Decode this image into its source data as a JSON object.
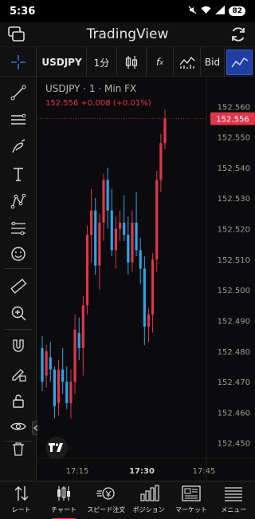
{
  "status_bar": {
    "time": "5:36",
    "battery": "82"
  },
  "header": {
    "title": "TradingView"
  },
  "toolbar": {
    "symbol": "USDJPY",
    "interval": "1分",
    "fx_label": "f",
    "fx_sub": "x",
    "price_source": "Bid"
  },
  "legend": {
    "title": "USDJPY · 1 · Min FX",
    "last": "152.556",
    "change": "+0.008 (+0.01%)"
  },
  "colors": {
    "up": "#e0364a",
    "down": "#2fa4e7",
    "accent": "#1f3fa3",
    "label_bg": "#e0364a"
  },
  "chart_data": {
    "type": "candlestick",
    "title": "USDJPY · 1 · Min FX",
    "y_ticks": [
      "152.560",
      "152.550",
      "152.540",
      "152.530",
      "152.520",
      "152.510",
      "152.500",
      "152.490",
      "152.480",
      "152.470",
      "152.460",
      "152.450"
    ],
    "x_ticks": [
      "17:15",
      "17:30",
      "17:45"
    ],
    "ylim": [
      152.446,
      152.564
    ],
    "last_price_label": "152.556",
    "candles": [
      {
        "o": 152.481,
        "h": 152.485,
        "l": 152.467,
        "c": 152.47
      },
      {
        "o": 152.472,
        "h": 152.482,
        "l": 152.468,
        "c": 152.48
      },
      {
        "o": 152.478,
        "h": 152.483,
        "l": 152.47,
        "c": 152.474
      },
      {
        "o": 152.474,
        "h": 152.475,
        "l": 152.458,
        "c": 152.462
      },
      {
        "o": 152.463,
        "h": 152.477,
        "l": 152.459,
        "c": 152.474
      },
      {
        "o": 152.474,
        "h": 152.481,
        "l": 152.466,
        "c": 152.47
      },
      {
        "o": 152.47,
        "h": 152.475,
        "l": 152.461,
        "c": 152.463
      },
      {
        "o": 152.463,
        "h": 152.474,
        "l": 152.458,
        "c": 152.47
      },
      {
        "o": 152.47,
        "h": 152.492,
        "l": 152.466,
        "c": 152.487
      },
      {
        "o": 152.486,
        "h": 152.491,
        "l": 152.477,
        "c": 152.481
      },
      {
        "o": 152.481,
        "h": 152.498,
        "l": 152.472,
        "c": 152.495
      },
      {
        "o": 152.495,
        "h": 152.521,
        "l": 152.492,
        "c": 152.518
      },
      {
        "o": 152.518,
        "h": 152.533,
        "l": 152.509,
        "c": 152.526
      },
      {
        "o": 152.526,
        "h": 152.53,
        "l": 152.505,
        "c": 152.508
      },
      {
        "o": 152.508,
        "h": 152.525,
        "l": 152.5,
        "c": 152.522
      },
      {
        "o": 152.522,
        "h": 152.538,
        "l": 152.516,
        "c": 152.536
      },
      {
        "o": 152.536,
        "h": 152.54,
        "l": 152.52,
        "c": 152.526
      },
      {
        "o": 152.526,
        "h": 152.533,
        "l": 152.511,
        "c": 152.513
      },
      {
        "o": 152.513,
        "h": 152.524,
        "l": 152.507,
        "c": 152.52
      },
      {
        "o": 152.52,
        "h": 152.526,
        "l": 152.516,
        "c": 152.522
      },
      {
        "o": 152.522,
        "h": 152.531,
        "l": 152.516,
        "c": 152.518
      },
      {
        "o": 152.518,
        "h": 152.524,
        "l": 152.505,
        "c": 152.509
      },
      {
        "o": 152.509,
        "h": 152.526,
        "l": 152.506,
        "c": 152.522
      },
      {
        "o": 152.522,
        "h": 152.532,
        "l": 152.511,
        "c": 152.513
      },
      {
        "o": 152.513,
        "h": 152.517,
        "l": 152.502,
        "c": 152.507
      },
      {
        "o": 152.507,
        "h": 152.511,
        "l": 152.482,
        "c": 152.488
      },
      {
        "o": 152.488,
        "h": 152.494,
        "l": 152.483,
        "c": 152.492
      },
      {
        "o": 152.492,
        "h": 152.512,
        "l": 152.486,
        "c": 152.51
      },
      {
        "o": 152.51,
        "h": 152.539,
        "l": 152.506,
        "c": 152.536
      },
      {
        "o": 152.536,
        "h": 152.551,
        "l": 152.532,
        "c": 152.548
      },
      {
        "o": 152.548,
        "h": 152.559,
        "l": 152.546,
        "c": 152.556
      }
    ]
  },
  "bottom_nav": [
    {
      "label": "レート",
      "icon": "sort-arrows-icon"
    },
    {
      "label": "チャート",
      "icon": "candles-icon",
      "active": true
    },
    {
      "label": "スピード注文",
      "icon": "speed-order-icon"
    },
    {
      "label": "ポジション",
      "icon": "bars-icon"
    },
    {
      "label": "マーケット",
      "icon": "news-icon"
    },
    {
      "label": "メニュー",
      "icon": "menu-icon"
    }
  ]
}
